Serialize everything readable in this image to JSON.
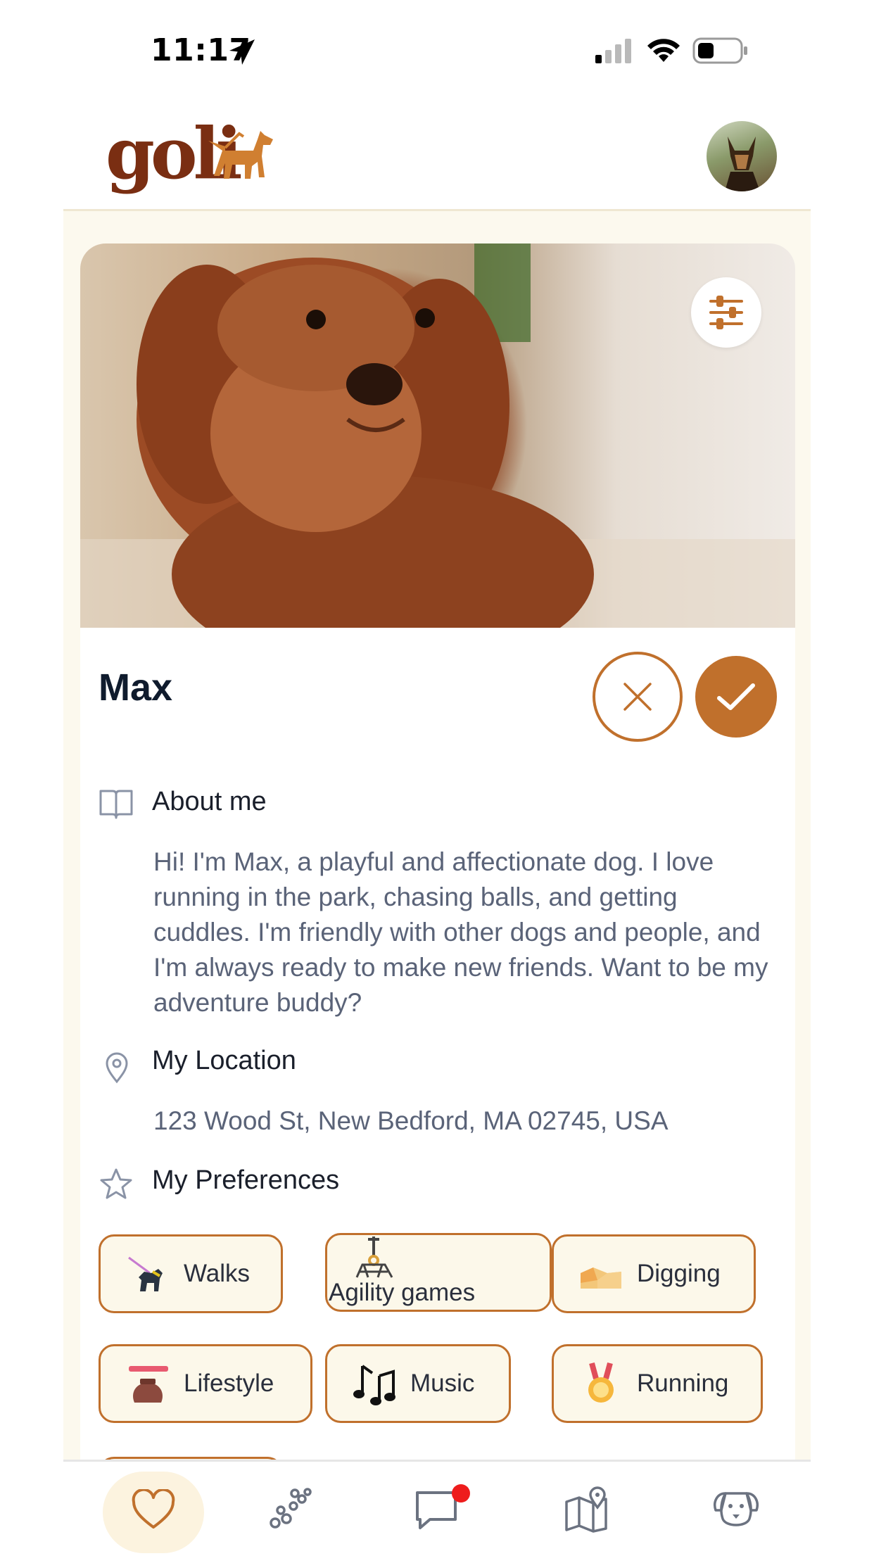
{
  "status_bar": {
    "time": "11:17"
  },
  "header": {
    "logo_text": "goli"
  },
  "profile": {
    "name": "Max",
    "about_title": "About me",
    "about_text": "Hi! I'm Max, a playful and affectionate dog. I love running in the park, chasing balls, and getting cuddles. I'm friendly with other dogs and people, and I'm always ready to make new friends. Want to be my adventure buddy?",
    "location_title": "My Location",
    "location_text": "123 Wood St, New Bedford, MA 02745, USA",
    "preferences_title": "My Preferences",
    "preferences": [
      {
        "label": "Walks",
        "icon": "dog-leash-icon"
      },
      {
        "label": "Agility games",
        "icon": "agility-icon"
      },
      {
        "label": "Digging",
        "icon": "digging-icon"
      },
      {
        "label": "Lifestyle",
        "icon": "lifestyle-icon"
      },
      {
        "label": "Music",
        "icon": "music-notes-icon"
      },
      {
        "label": "Running",
        "icon": "medal-icon"
      }
    ]
  },
  "bottom_nav": [
    "heart-icon",
    "paw-icon",
    "chat-icon",
    "map-icon",
    "dog-face-icon"
  ],
  "colors": {
    "accent": "#c0702c",
    "background": "#fcf9ee",
    "notification": "#ee1c1c"
  }
}
